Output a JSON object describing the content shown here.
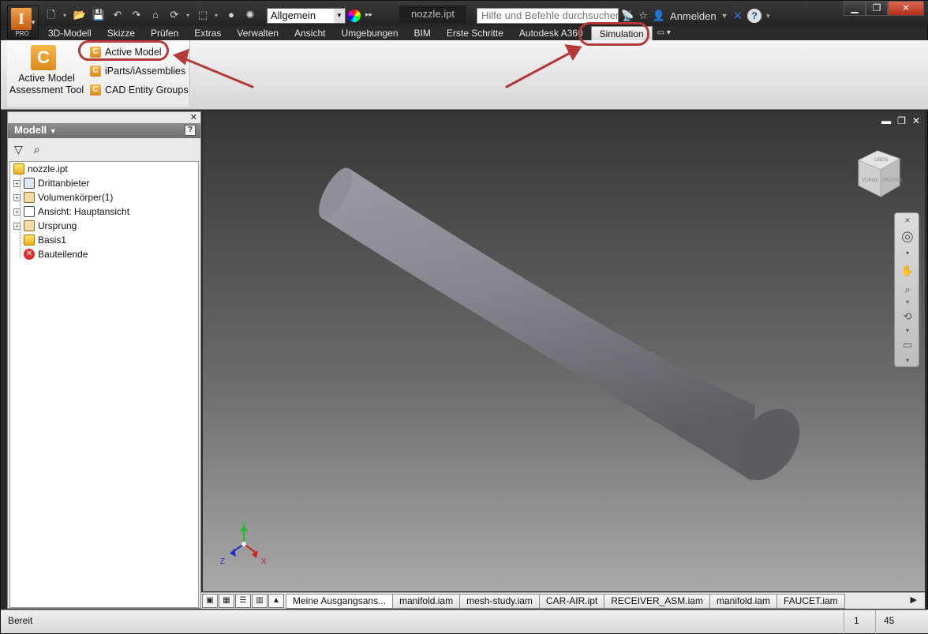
{
  "app": {
    "badge": "PRO"
  },
  "qat": {
    "workspace_value": "Allgemein"
  },
  "window": {
    "doc_title": "nozzle.ipt"
  },
  "search": {
    "placeholder": "Hilfe und Befehle durchsuchen..."
  },
  "account": {
    "signin_label": "Anmelden"
  },
  "ribbon_tabs": [
    {
      "label": "3D-Modell"
    },
    {
      "label": "Skizze"
    },
    {
      "label": "Prüfen"
    },
    {
      "label": "Extras"
    },
    {
      "label": "Verwalten"
    },
    {
      "label": "Ansicht"
    },
    {
      "label": "Umgebungen"
    },
    {
      "label": "BIM"
    },
    {
      "label": "Erste Schritte"
    },
    {
      "label": "Autodesk A360"
    },
    {
      "label": "Simulation"
    }
  ],
  "ribbon": {
    "big_button_line1": "Active Model",
    "big_button_line2": "Assessment Tool",
    "small_buttons": [
      {
        "label": "Active Model"
      },
      {
        "label": "iParts/iAssemblies"
      },
      {
        "label": "CAD Entity Groups"
      }
    ]
  },
  "browser": {
    "title": "Modell",
    "nodes": [
      {
        "label": "nozzle.ipt"
      },
      {
        "label": "Drittanbieter"
      },
      {
        "label": "Volumenkörper(1)"
      },
      {
        "label": "Ansicht: Hauptansicht"
      },
      {
        "label": "Ursprung"
      },
      {
        "label": "Basis1"
      },
      {
        "label": "Bauteilende"
      }
    ]
  },
  "viewcube": {
    "top_label": "OBEN",
    "front_label": "VORNE",
    "right_label": "RECHTS"
  },
  "axes": {
    "x": "X",
    "y": "Y",
    "z": "Z"
  },
  "doc_tabs": [
    {
      "label": "Meine Ausgangsans..."
    },
    {
      "label": "manifold.iam"
    },
    {
      "label": "mesh-study.iam"
    },
    {
      "label": "CAR-AIR.ipt"
    },
    {
      "label": "RECEIVER_ASM.iam"
    },
    {
      "label": "manifold.iam"
    },
    {
      "label": "FAUCET.iam"
    }
  ],
  "status": {
    "text": "Bereit",
    "count1": "1",
    "count2": "45"
  },
  "colors": {
    "annotation": "#b43a3a",
    "accent": "#e3892a"
  }
}
